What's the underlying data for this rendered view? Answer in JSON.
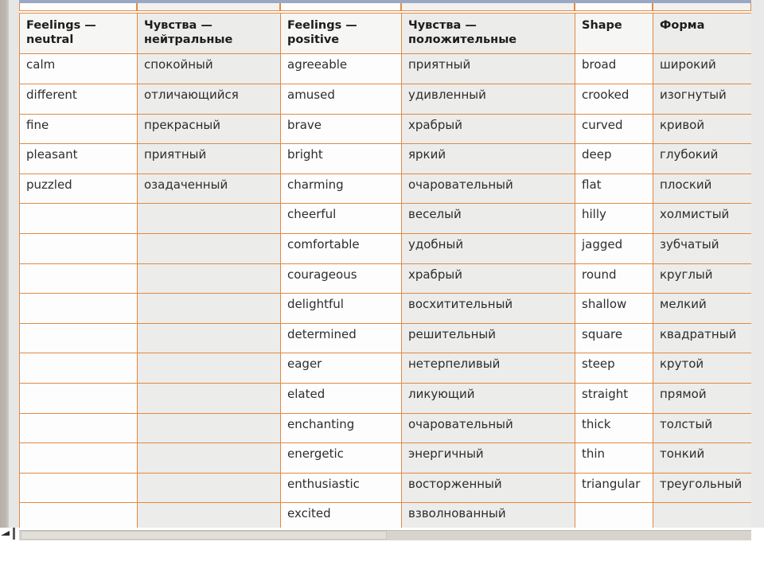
{
  "document": {
    "type": "vocabulary-table",
    "languages": [
      "English",
      "Russian"
    ]
  },
  "table": {
    "headers": [
      {
        "line1": "Feelings —",
        "line2": "neutral",
        "lang": "en",
        "key": "feelings-neutral"
      },
      {
        "line1": "Чувства —",
        "line2": "нейтральные",
        "lang": "ru",
        "key": "chuvstva-neutral"
      },
      {
        "line1": "Feelings —",
        "line2": "positive",
        "lang": "en",
        "key": "feelings-positive"
      },
      {
        "line1": "Чувства —",
        "line2": "положительные",
        "lang": "ru",
        "key": "chuvstva-positive"
      },
      {
        "line1": "Shape",
        "line2": "",
        "lang": "en",
        "key": "shape"
      },
      {
        "line1": "Форма",
        "line2": "",
        "lang": "ru",
        "key": "forma"
      }
    ],
    "rows": [
      [
        "calm",
        "спокойный",
        "agreeable",
        "приятный",
        "broad",
        "широкий"
      ],
      [
        "different",
        "отличающийся",
        "amused",
        "удивленный",
        "crooked",
        "изогнутый"
      ],
      [
        "fine",
        "прекрасный",
        "brave",
        "храбрый",
        "curved",
        "кривой"
      ],
      [
        "pleasant",
        "приятный",
        "bright",
        "яркий",
        "deep",
        "глубокий"
      ],
      [
        "puzzled",
        "озадаченный",
        "charming",
        "очаровательный",
        "flat",
        "плоский"
      ],
      [
        "",
        "",
        "cheerful",
        "веселый",
        "hilly",
        "холмистый"
      ],
      [
        "",
        "",
        "comfortable",
        "удобный",
        "jagged",
        "зубчатый"
      ],
      [
        "",
        "",
        "courageous",
        "храбрый",
        "round",
        "круглый"
      ],
      [
        "",
        "",
        "delightful",
        "восхитительный",
        "shallow",
        "мелкий"
      ],
      [
        "",
        "",
        "determined",
        "решительный",
        "square",
        "квадратный"
      ],
      [
        "",
        "",
        "eager",
        "нетерпеливый",
        "steep",
        "крутой"
      ],
      [
        "",
        "",
        "elated",
        "ликующий",
        "straight",
        "прямой"
      ],
      [
        "",
        "",
        "enchanting",
        "очаровательный",
        "thick",
        "толстый"
      ],
      [
        "",
        "",
        "energetic",
        "энергичный",
        "thin",
        "тонкий"
      ],
      [
        "",
        "",
        "enthusiastic",
        "восторженный",
        "triangular",
        "треугольный"
      ],
      [
        "",
        "",
        "excited",
        "взволнованный",
        "",
        ""
      ]
    ]
  },
  "colors": {
    "border": "#e08a43",
    "cell_en_bg": "#fdfdfd",
    "cell_ru_bg": "#ececeb",
    "header_bg": "#f2f1ef",
    "text": "#2d2d2d",
    "chrome_top": "#9aa8c4"
  },
  "scrollbars": {
    "horizontal_present": true,
    "vertical_present": true
  }
}
